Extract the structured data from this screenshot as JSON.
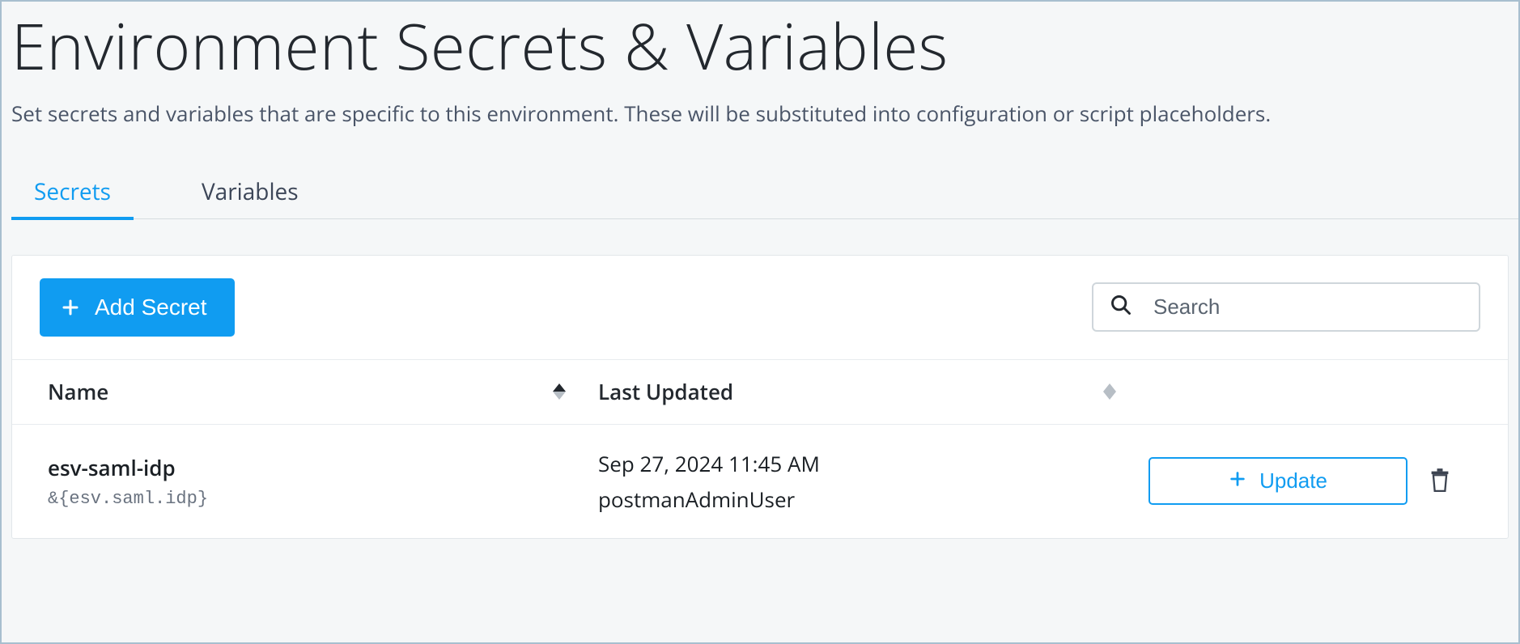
{
  "header": {
    "title": "Environment Secrets & Variables",
    "subtitle": "Set secrets and variables that are specific to this environment. These will be substituted into configuration or script placeholders."
  },
  "tabs": [
    {
      "label": "Secrets",
      "active": true
    },
    {
      "label": "Variables",
      "active": false
    }
  ],
  "toolbar": {
    "add_label": "Add Secret"
  },
  "search": {
    "placeholder": "Search",
    "value": ""
  },
  "table": {
    "columns": {
      "name": "Name",
      "last_updated": "Last Updated"
    },
    "rows": [
      {
        "name": "esv-saml-idp",
        "placeholder": "&{esv.saml.idp}",
        "updated_date": "Sep 27, 2024 11:45 AM",
        "updated_by": "postmanAdminUser",
        "update_label": "Update"
      }
    ]
  },
  "colors": {
    "accent": "#109cf1"
  }
}
